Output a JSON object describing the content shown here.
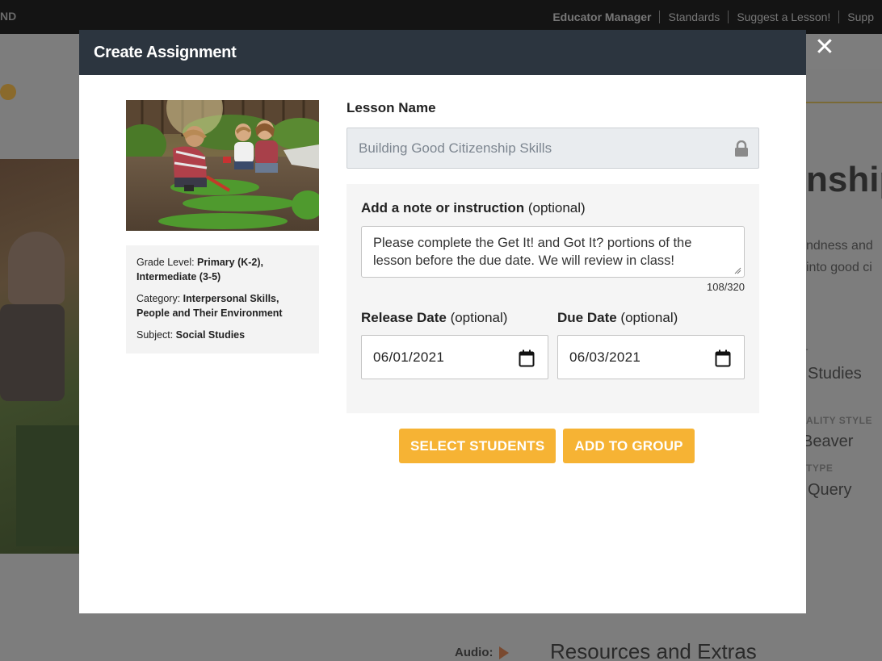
{
  "background": {
    "brand": "ND",
    "nav": [
      "Educator Manager",
      "Standards",
      "Suggest a Lesson!",
      "Supp"
    ],
    "title_fragment": "nship",
    "text_line1": "ndness and",
    "text_line2": "into good ci",
    "label_small1": "T",
    "value1": "Studies",
    "label_small2": "ALITY STYLE",
    "value2": "Beaver",
    "label_small3": "TYPE",
    "value3": "Query",
    "audio_label": "Audio:",
    "resources_heading": "Resources and Extras"
  },
  "modal": {
    "title": "Create Assignment",
    "close_label": "✕",
    "lesson_info": {
      "grade_label": "Grade Level: ",
      "grade_value": "Primary (K-2), Intermediate (3-5)",
      "category_label": "Category: ",
      "category_value": "Interpersonal Skills, People and Their Environment",
      "subject_label": "Subject: ",
      "subject_value": "Social Studies"
    },
    "form": {
      "lesson_name_label": "Lesson Name",
      "lesson_name_value": "Building Good Citizenship Skills",
      "note_label": "Add a note or instruction",
      "optional_text": " (optional)",
      "note_value": "Please complete the Get It! and Got It? portions of the lesson before the due date. We will review in class!",
      "char_counter": "108/320",
      "release_label": "Release Date",
      "release_value": "06/01/2021",
      "due_label": "Due Date",
      "due_value": "06/03/2021"
    },
    "buttons": {
      "select_students": "SELECT STUDENTS",
      "add_to_group": "ADD TO GROUP"
    }
  },
  "colors": {
    "header_bg": "#2c353f",
    "accent_button": "#f6b334",
    "input_disabled_bg": "#e9ecef",
    "panel_bg": "#f5f5f5"
  }
}
